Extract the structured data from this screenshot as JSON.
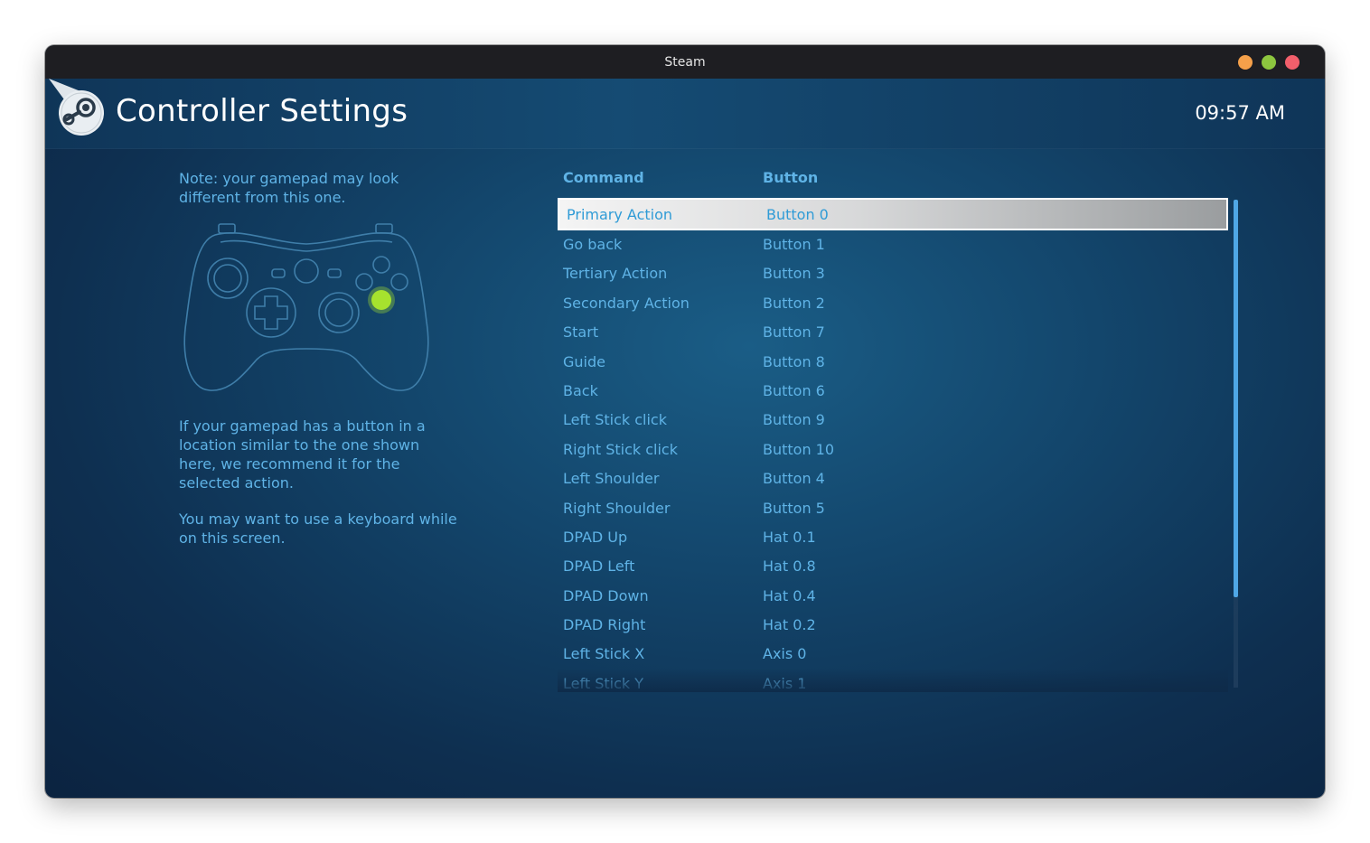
{
  "window": {
    "title": "Steam"
  },
  "header": {
    "title": "Controller Settings",
    "clock": "09:57 AM"
  },
  "left_panel": {
    "note": "Note: your gamepad may look different from this one.",
    "recommend": "If your gamepad has a button in a location similar to the one shown here, we recommend it for the selected action.",
    "keyboard": "You may want to use a keyboard while on this screen."
  },
  "table": {
    "headers": {
      "command": "Command",
      "button": "Button"
    },
    "rows": [
      {
        "command": "Primary Action",
        "button": "Button 0",
        "selected": true
      },
      {
        "command": "Go back",
        "button": "Button 1"
      },
      {
        "command": "Tertiary Action",
        "button": "Button 3"
      },
      {
        "command": "Secondary Action",
        "button": "Button 2"
      },
      {
        "command": "Start",
        "button": "Button 7"
      },
      {
        "command": "Guide",
        "button": "Button 8"
      },
      {
        "command": "Back",
        "button": "Button 6"
      },
      {
        "command": "Left Stick click",
        "button": "Button 9"
      },
      {
        "command": "Right Stick click",
        "button": "Button 10"
      },
      {
        "command": "Left Shoulder",
        "button": "Button 4"
      },
      {
        "command": "Right Shoulder",
        "button": "Button 5"
      },
      {
        "command": "DPAD Up",
        "button": "Hat 0.1"
      },
      {
        "command": "DPAD Left",
        "button": "Hat 0.8"
      },
      {
        "command": "DPAD Down",
        "button": "Hat 0.4"
      },
      {
        "command": "DPAD Right",
        "button": "Hat 0.2"
      },
      {
        "command": "Left Stick X",
        "button": "Axis 0"
      },
      {
        "command": "Left Stick Y",
        "button": "Axis 1"
      }
    ]
  },
  "colors": {
    "accent_text": "#5fb3e6",
    "highlight_button": "#a6e22e",
    "scroll_thumb": "#4fa7e6"
  },
  "icons": {
    "logo": "steam-logo-icon",
    "gamepad": "gamepad-outline-icon"
  }
}
